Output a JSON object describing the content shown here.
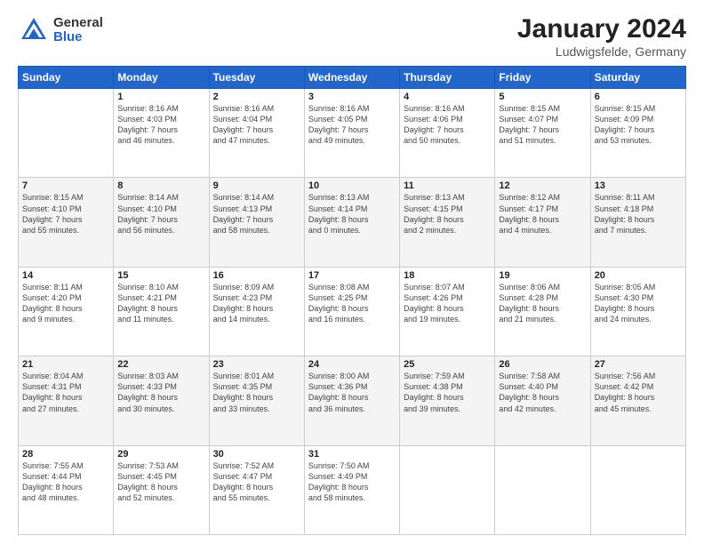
{
  "header": {
    "logo_general": "General",
    "logo_blue": "Blue",
    "title": "January 2024",
    "location": "Ludwigsfelde, Germany"
  },
  "days_of_week": [
    "Sunday",
    "Monday",
    "Tuesday",
    "Wednesday",
    "Thursday",
    "Friday",
    "Saturday"
  ],
  "weeks": [
    [
      {
        "day": "",
        "info": ""
      },
      {
        "day": "1",
        "info": "Sunrise: 8:16 AM\nSunset: 4:03 PM\nDaylight: 7 hours\nand 46 minutes."
      },
      {
        "day": "2",
        "info": "Sunrise: 8:16 AM\nSunset: 4:04 PM\nDaylight: 7 hours\nand 47 minutes."
      },
      {
        "day": "3",
        "info": "Sunrise: 8:16 AM\nSunset: 4:05 PM\nDaylight: 7 hours\nand 49 minutes."
      },
      {
        "day": "4",
        "info": "Sunrise: 8:16 AM\nSunset: 4:06 PM\nDaylight: 7 hours\nand 50 minutes."
      },
      {
        "day": "5",
        "info": "Sunrise: 8:15 AM\nSunset: 4:07 PM\nDaylight: 7 hours\nand 51 minutes."
      },
      {
        "day": "6",
        "info": "Sunrise: 8:15 AM\nSunset: 4:09 PM\nDaylight: 7 hours\nand 53 minutes."
      }
    ],
    [
      {
        "day": "7",
        "info": ""
      },
      {
        "day": "8",
        "info": "Sunrise: 8:14 AM\nSunset: 4:10 PM\nDaylight: 7 hours\nand 56 minutes."
      },
      {
        "day": "9",
        "info": "Sunrise: 8:14 AM\nSunset: 4:13 PM\nDaylight: 7 hours\nand 58 minutes."
      },
      {
        "day": "10",
        "info": "Sunrise: 8:13 AM\nSunset: 4:14 PM\nDaylight: 8 hours\nand 0 minutes."
      },
      {
        "day": "11",
        "info": "Sunrise: 8:13 AM\nSunset: 4:15 PM\nDaylight: 8 hours\nand 2 minutes."
      },
      {
        "day": "12",
        "info": "Sunrise: 8:12 AM\nSunset: 4:17 PM\nDaylight: 8 hours\nand 4 minutes."
      },
      {
        "day": "13",
        "info": "Sunrise: 8:11 AM\nSunset: 4:18 PM\nDaylight: 8 hours\nand 7 minutes."
      }
    ],
    [
      {
        "day": "14",
        "info": ""
      },
      {
        "day": "15",
        "info": "Sunrise: 8:10 AM\nSunset: 4:21 PM\nDaylight: 8 hours\nand 11 minutes."
      },
      {
        "day": "16",
        "info": "Sunrise: 8:09 AM\nSunset: 4:23 PM\nDaylight: 8 hours\nand 14 minutes."
      },
      {
        "day": "17",
        "info": "Sunrise: 8:08 AM\nSunset: 4:25 PM\nDaylight: 8 hours\nand 16 minutes."
      },
      {
        "day": "18",
        "info": "Sunrise: 8:07 AM\nSunset: 4:26 PM\nDaylight: 8 hours\nand 19 minutes."
      },
      {
        "day": "19",
        "info": "Sunrise: 8:06 AM\nSunset: 4:28 PM\nDaylight: 8 hours\nand 21 minutes."
      },
      {
        "day": "20",
        "info": "Sunrise: 8:05 AM\nSunset: 4:30 PM\nDaylight: 8 hours\nand 24 minutes."
      }
    ],
    [
      {
        "day": "21",
        "info": ""
      },
      {
        "day": "22",
        "info": "Sunrise: 8:03 AM\nSunset: 4:33 PM\nDaylight: 8 hours\nand 30 minutes."
      },
      {
        "day": "23",
        "info": "Sunrise: 8:01 AM\nSunset: 4:35 PM\nDaylight: 8 hours\nand 33 minutes."
      },
      {
        "day": "24",
        "info": "Sunrise: 8:00 AM\nSunset: 4:36 PM\nDaylight: 8 hours\nand 36 minutes."
      },
      {
        "day": "25",
        "info": "Sunrise: 7:59 AM\nSunset: 4:38 PM\nDaylight: 8 hours\nand 39 minutes."
      },
      {
        "day": "26",
        "info": "Sunrise: 7:58 AM\nSunset: 4:40 PM\nDaylight: 8 hours\nand 42 minutes."
      },
      {
        "day": "27",
        "info": "Sunrise: 7:56 AM\nSunset: 4:42 PM\nDaylight: 8 hours\nand 45 minutes."
      }
    ],
    [
      {
        "day": "28",
        "info": "Sunrise: 7:55 AM\nSunset: 4:44 PM\nDaylight: 8 hours\nand 48 minutes."
      },
      {
        "day": "29",
        "info": "Sunrise: 7:53 AM\nSunset: 4:45 PM\nDaylight: 8 hours\nand 52 minutes."
      },
      {
        "day": "30",
        "info": "Sunrise: 7:52 AM\nSunset: 4:47 PM\nDaylight: 8 hours\nand 55 minutes."
      },
      {
        "day": "31",
        "info": "Sunrise: 7:50 AM\nSunset: 4:49 PM\nDaylight: 8 hours\nand 58 minutes."
      },
      {
        "day": "",
        "info": ""
      },
      {
        "day": "",
        "info": ""
      },
      {
        "day": "",
        "info": ""
      }
    ]
  ],
  "week1_sunday_info": "Sunrise: 8:15 AM\nSunset: 4:10 PM\nDaylight: 7 hours\nand 55 minutes.",
  "week3_sunday_info": "Sunrise: 8:11 AM\nSunset: 4:20 PM\nDaylight: 8 hours\nand 9 minutes.",
  "week4_sunday_info": "Sunrise: 8:04 AM\nSunset: 4:31 PM\nDaylight: 8 hours\nand 27 minutes."
}
